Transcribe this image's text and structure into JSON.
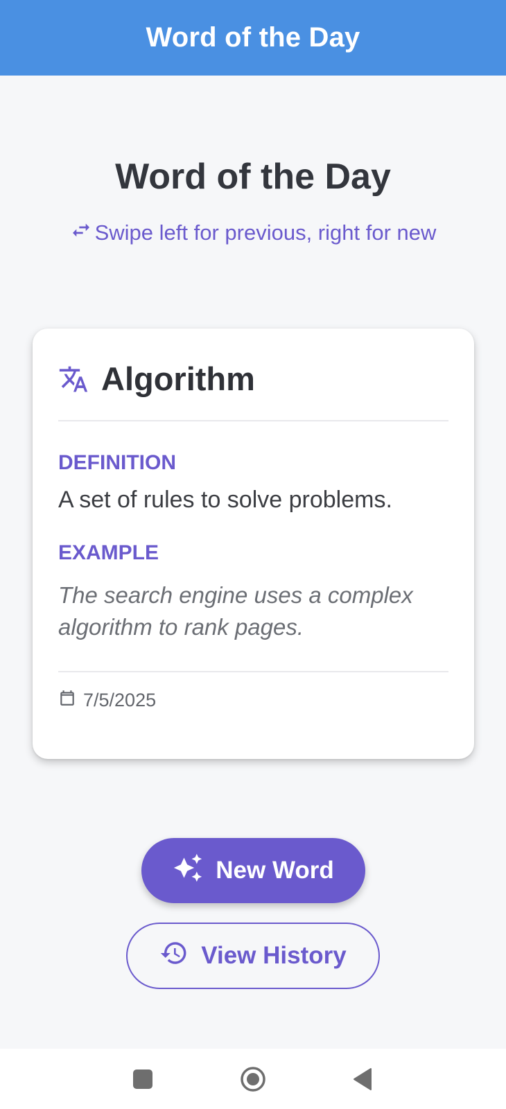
{
  "appbar": {
    "title": "Word of the Day"
  },
  "header": {
    "title": "Word of the Day",
    "swipe_hint": "Swipe left for previous, right for new"
  },
  "card": {
    "word": "Algorithm",
    "definition_label": "DEFINITION",
    "definition": "A set of rules to solve problems.",
    "example_label": "EXAMPLE",
    "example": "The search engine uses a complex algorithm to rank pages.",
    "date": "7/5/2025"
  },
  "actions": {
    "new_word_label": "New Word",
    "view_history_label": "View History"
  },
  "icons": {
    "swipe": "swap-horiz-icon",
    "translate": "translate-icon",
    "calendar": "calendar-icon",
    "sparkle": "auto-awesome-icon",
    "history": "history-icon",
    "nav_recents": "square-icon",
    "nav_home": "circle-icon",
    "nav_back": "triangle-back-icon"
  },
  "colors": {
    "appbar": "#4a90e2",
    "accent": "#6a5acd",
    "background": "#f6f7f9",
    "text_dark": "#33363d"
  }
}
